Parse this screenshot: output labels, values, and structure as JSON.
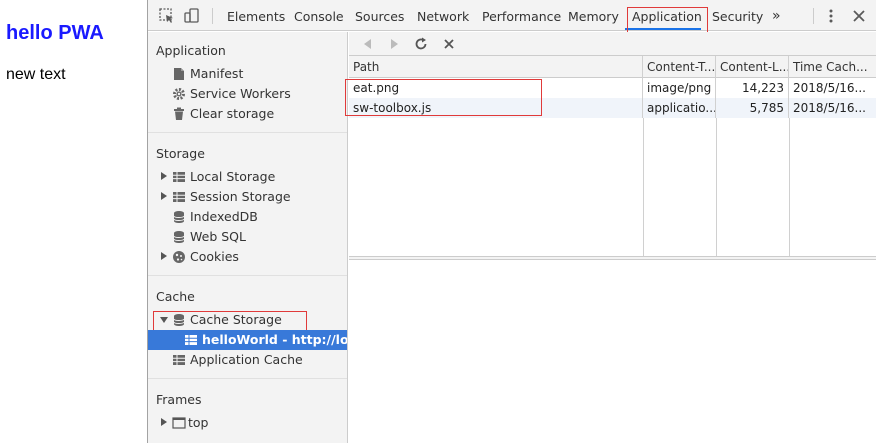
{
  "page": {
    "title": "hello PWA",
    "text": "new text"
  },
  "devtools": {
    "tabs": [
      "Elements",
      "Console",
      "Sources",
      "Network",
      "Performance",
      "Memory",
      "Application",
      "Security"
    ],
    "active_tab": "Application",
    "more_tabs": "»"
  },
  "sidebar": {
    "application": {
      "title": "Application",
      "items": [
        "Manifest",
        "Service Workers",
        "Clear storage"
      ]
    },
    "storage": {
      "title": "Storage",
      "items": [
        "Local Storage",
        "Session Storage",
        "IndexedDB",
        "Web SQL",
        "Cookies"
      ]
    },
    "cache": {
      "title": "Cache",
      "items": [
        "Cache Storage",
        "helloWorld - http://localhost",
        "Application Cache"
      ]
    },
    "frames": {
      "title": "Frames",
      "items": [
        "top"
      ]
    }
  },
  "table": {
    "columns": [
      "Path",
      "Content-T...",
      "Content-L...",
      "Time Cach..."
    ],
    "rows": [
      {
        "path": "eat.png",
        "type": "image/png",
        "length": "14,223",
        "time": "2018/5/16..."
      },
      {
        "path": "sw-toolbox.js",
        "type": "applicatio...",
        "length": "5,785",
        "time": "2018/5/16..."
      }
    ]
  },
  "colors": {
    "highlight": "#e03a3a",
    "selected": "#3879d9",
    "accent": "#1a73e8"
  }
}
